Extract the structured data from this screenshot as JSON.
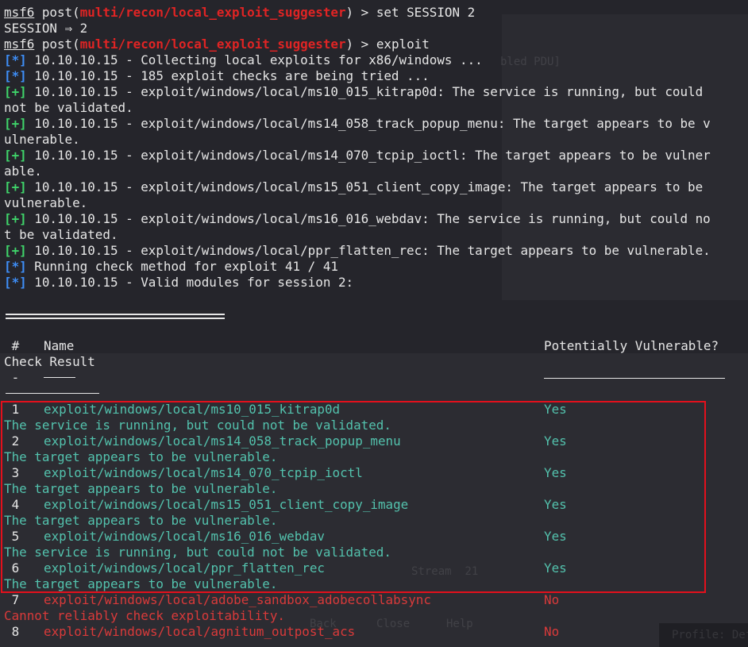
{
  "prompt1": {
    "prefix": "msf6",
    "cmd": " post(",
    "module": "multi/recon/local_exploit_suggester",
    "suffix": ") > set SESSION 2"
  },
  "session_line": "SESSION ⇒ 2",
  "prompt2": {
    "prefix": "msf6",
    "cmd": " post(",
    "module": "multi/recon/local_exploit_suggester",
    "suffix": ") > exploit"
  },
  "log": [
    {
      "tag": "[*]",
      "tag_kind": "info",
      "text": " 10.10.10.15 - Collecting local exploits for x86/windows ..."
    },
    {
      "tag": "[*]",
      "tag_kind": "info",
      "text": " 10.10.10.15 - 185 exploit checks are being tried ..."
    },
    {
      "tag": "[+]",
      "tag_kind": "good",
      "text": " 10.10.10.15 - exploit/windows/local/ms10_015_kitrap0d: The service is running, but could"
    },
    {
      "tag": "",
      "tag_kind": "none",
      "text": "not be validated."
    },
    {
      "tag": "[+]",
      "tag_kind": "good",
      "text": " 10.10.10.15 - exploit/windows/local/ms14_058_track_popup_menu: The target appears to be v"
    },
    {
      "tag": "",
      "tag_kind": "none",
      "text": "ulnerable."
    },
    {
      "tag": "[+]",
      "tag_kind": "good",
      "text": " 10.10.10.15 - exploit/windows/local/ms14_070_tcpip_ioctl: The target appears to be vulner"
    },
    {
      "tag": "",
      "tag_kind": "none",
      "text": "able."
    },
    {
      "tag": "[+]",
      "tag_kind": "good",
      "text": " 10.10.10.15 - exploit/windows/local/ms15_051_client_copy_image: The target appears to be"
    },
    {
      "tag": "",
      "tag_kind": "none",
      "text": "vulnerable."
    },
    {
      "tag": "[+]",
      "tag_kind": "good",
      "text": " 10.10.10.15 - exploit/windows/local/ms16_016_webdav: The service is running, but could no"
    },
    {
      "tag": "",
      "tag_kind": "none",
      "text": "t be validated."
    },
    {
      "tag": "[+]",
      "tag_kind": "good",
      "text": " 10.10.10.15 - exploit/windows/local/ppr_flatten_rec: The target appears to be vulnerable."
    },
    {
      "tag": "[*]",
      "tag_kind": "info",
      "text": " Running check method for exploit 41 / 41"
    },
    {
      "tag": "[*]",
      "tag_kind": "info",
      "text": " 10.10.10.15 - Valid modules for session 2:"
    }
  ],
  "table": {
    "header_num": " #",
    "header_name": "Name",
    "header_vuln": "Potentially Vulnerable?",
    "header_check": "Check Result",
    "sep_num": " -",
    "sep_name": "----",
    "rows": [
      {
        "num": " 1",
        "name": "exploit/windows/local/ms10_015_kitrap0d",
        "vuln": "Yes",
        "result": "The service is running, but could not be validated.",
        "ok": true
      },
      {
        "num": " 2",
        "name": "exploit/windows/local/ms14_058_track_popup_menu",
        "vuln": "Yes",
        "result": "The target appears to be vulnerable.",
        "ok": true
      },
      {
        "num": " 3",
        "name": "exploit/windows/local/ms14_070_tcpip_ioctl",
        "vuln": "Yes",
        "result": "The target appears to be vulnerable.",
        "ok": true
      },
      {
        "num": " 4",
        "name": "exploit/windows/local/ms15_051_client_copy_image",
        "vuln": "Yes",
        "result": "The target appears to be vulnerable.",
        "ok": true
      },
      {
        "num": " 5",
        "name": "exploit/windows/local/ms16_016_webdav",
        "vuln": "Yes",
        "result": "The service is running, but could not be validated.",
        "ok": true
      },
      {
        "num": " 6",
        "name": "exploit/windows/local/ppr_flatten_rec",
        "vuln": "Yes",
        "result": "The target appears to be vulnerable.",
        "ok": true
      },
      {
        "num": " 7",
        "name": "exploit/windows/local/adobe_sandbox_adobecollabsync",
        "vuln": "No",
        "result": "Cannot reliably check exploitability.",
        "ok": false
      },
      {
        "num": " 8",
        "name": "exploit/windows/local/agnitum_outpost_acs",
        "vuln": "No",
        "result": "",
        "ok": false
      }
    ]
  },
  "ghost": {
    "a": "bled PDU]",
    "b": "Stream  21",
    "c": "Back",
    "d": "Close",
    "e": "Help",
    "f": "Profile: Default"
  },
  "colors": {
    "background": "#25252b",
    "module_red": "#e02424",
    "info_blue": "#3e8ef7",
    "good_green": "#3fd46a",
    "row_teal": "#53c2ad",
    "highlight_box": "#e3101c"
  }
}
